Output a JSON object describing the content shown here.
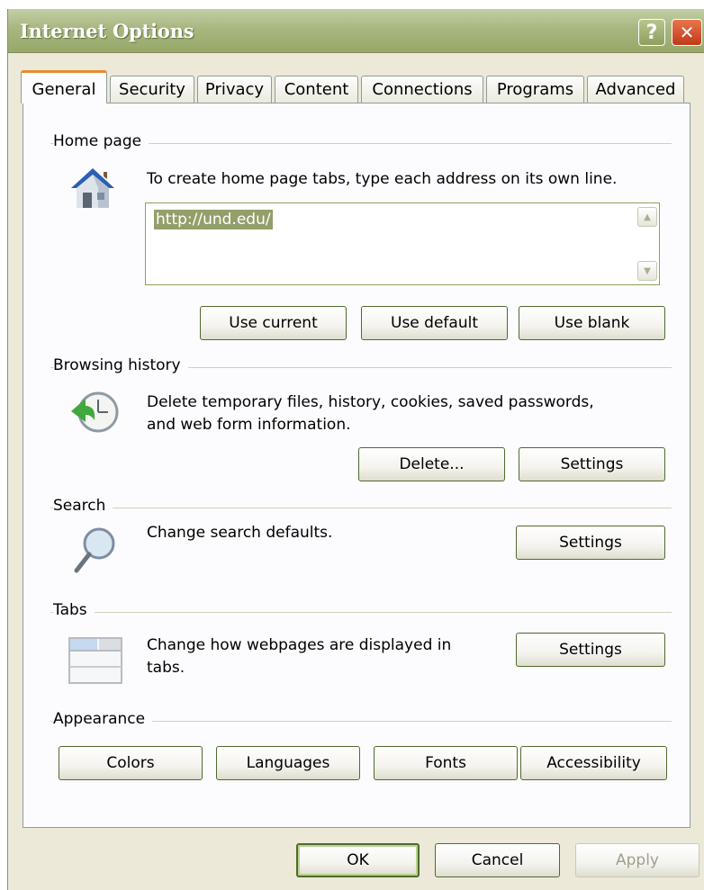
{
  "window": {
    "title": "Internet Options",
    "help_glyph": "?",
    "close_glyph": "✕"
  },
  "tabs": [
    "General",
    "Security",
    "Privacy",
    "Content",
    "Connections",
    "Programs",
    "Advanced"
  ],
  "home_page": {
    "heading": "Home page",
    "instruction": "To create home page tabs, type each address on its own line.",
    "url": "http://und.edu/",
    "buttons": {
      "use_current": "Use current",
      "use_default": "Use default",
      "use_blank": "Use blank"
    },
    "icon": "home-icon"
  },
  "browsing_history": {
    "heading": "Browsing history",
    "description_line1": "Delete temporary files, history, cookies, saved passwords,",
    "description_line2": "and web form information.",
    "buttons": {
      "delete": "Delete...",
      "settings": "Settings"
    },
    "icon": "history-clock-icon"
  },
  "search": {
    "heading": "Search",
    "description": "Change search defaults.",
    "settings": "Settings",
    "icon": "magnifier-icon"
  },
  "tabs_section": {
    "heading": "Tabs",
    "description_line1": "Change how webpages are displayed in",
    "description_line2": "tabs.",
    "settings": "Settings",
    "icon": "tabs-window-icon"
  },
  "appearance": {
    "heading": "Appearance",
    "buttons": {
      "colors": "Colors",
      "languages": "Languages",
      "fonts": "Fonts",
      "accessibility": "Accessibility"
    }
  },
  "footer": {
    "ok": "OK",
    "cancel": "Cancel",
    "apply": "Apply"
  },
  "colors": {
    "title_bar": "#a7b77f",
    "close_button": "#c0391b",
    "active_tab_accent": "#e68b2c",
    "button_border": "#4f6a2e",
    "selection": "#939f6a"
  }
}
